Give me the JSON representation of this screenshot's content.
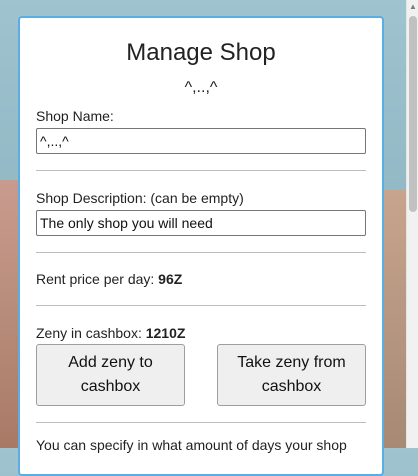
{
  "panel": {
    "title": "Manage Shop",
    "shop_name_display": "^,..,^",
    "shop_name_label": "Shop Name:",
    "shop_name_value": "^,..,^",
    "shop_description_label": "Shop Description: (can be empty)",
    "shop_description_value": "The only shop you will need",
    "rent_label": "Rent price per day: ",
    "rent_value": "96Z",
    "cashbox_label": "Zeny in cashbox: ",
    "cashbox_value": "1210Z",
    "add_button_label": "Add zeny to cashbox",
    "take_button_label": "Take zeny from cashbox",
    "footer_text": "You can specify in what amount of days your shop"
  },
  "colors": {
    "panel_border": "#5aaee3"
  }
}
